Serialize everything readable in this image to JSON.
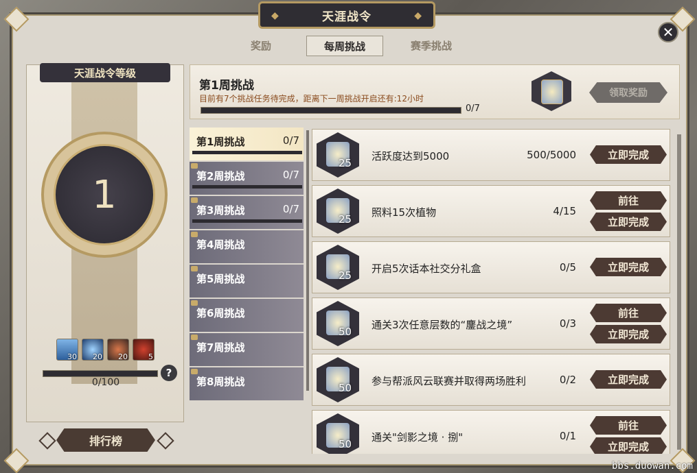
{
  "window": {
    "title": "天涯战令"
  },
  "tabs": [
    {
      "label": "奖励",
      "active": false
    },
    {
      "label": "每周挑战",
      "active": true
    },
    {
      "label": "赛季挑战",
      "active": false
    }
  ],
  "level_panel": {
    "header": "天涯战令等级",
    "level": "1",
    "items": [
      {
        "icon": "blue-book-icon",
        "count": "30"
      },
      {
        "icon": "blue-gem-icon",
        "count": "20"
      },
      {
        "icon": "food-bowl-icon",
        "count": "20"
      },
      {
        "icon": "red-chest-icon",
        "count": "5"
      }
    ],
    "progress_text": "0/100",
    "help": "?",
    "rank_button": "排行榜"
  },
  "summary": {
    "title": "第1周挑战",
    "desc": "目前有7个挑战任务待完成，距离下一周挑战开启还有:12小时",
    "progress": "0/7",
    "claim_button": "领取奖励"
  },
  "weeks": [
    {
      "label": "第1周挑战",
      "progress": "0/7"
    },
    {
      "label": "第2周挑战",
      "progress": "0/7"
    },
    {
      "label": "第3周挑战",
      "progress": "0/7"
    },
    {
      "label": "第4周挑战",
      "progress": ""
    },
    {
      "label": "第5周挑战",
      "progress": ""
    },
    {
      "label": "第6周挑战",
      "progress": ""
    },
    {
      "label": "第7周挑战",
      "progress": ""
    },
    {
      "label": "第8周挑战",
      "progress": ""
    }
  ],
  "tasks": [
    {
      "points": "25",
      "name": "活跃度达到5000",
      "progress": "500/5000",
      "buttons": [
        "立即完成"
      ]
    },
    {
      "points": "25",
      "name": "照料15次植物",
      "progress": "4/15",
      "buttons": [
        "前往",
        "立即完成"
      ]
    },
    {
      "points": "25",
      "name": "开启5次话本社交分礼盒",
      "progress": "0/5",
      "buttons": [
        "立即完成"
      ]
    },
    {
      "points": "50",
      "name": "通关3次任意层数的“鏖战之境”",
      "progress": "0/3",
      "buttons": [
        "前往",
        "立即完成"
      ]
    },
    {
      "points": "50",
      "name": "参与帮派风云联赛并取得两场胜利",
      "progress": "0/2",
      "buttons": [
        "立即完成"
      ]
    },
    {
      "points": "50",
      "name": "通关\"剑影之境 · 捌\"",
      "progress": "0/1",
      "buttons": [
        "前往",
        "立即完成"
      ]
    }
  ],
  "watermark": "bbs.duowan.com",
  "colors": {
    "panel": "#dcd7ce",
    "accent_gold": "#b59a62",
    "button_brown": "#4c3a33",
    "dark_plate": "#2f2d33"
  }
}
